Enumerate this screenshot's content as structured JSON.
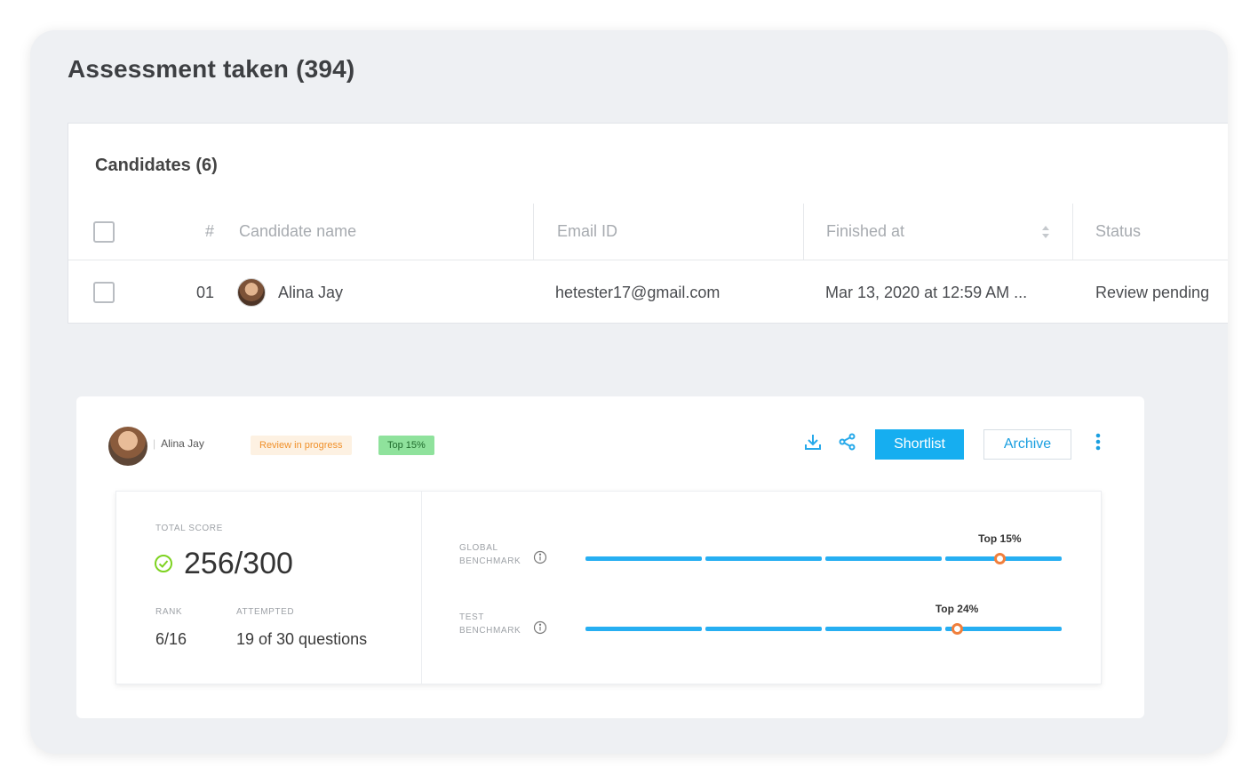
{
  "page": {
    "title": "Assessment taken (394)"
  },
  "candidates": {
    "title": "Candidates (6)",
    "columns": [
      "#",
      "Candidate name",
      "Email ID",
      "Finished at",
      "Status"
    ],
    "rows": [
      {
        "num": "01",
        "name": "Alina Jay",
        "email": "hetester17@gmail.com",
        "finished": "Mar 13, 2020 at 12:59 AM ...",
        "status": "Review pending"
      }
    ]
  },
  "detail": {
    "name": "Alina Jay",
    "badge_review": "Review in progress",
    "badge_top": "Top 15%",
    "shortlist_label": "Shortlist",
    "archive_label": "Archive",
    "total_score_label": "TOTAL SCORE",
    "total_score": "256/300",
    "rank_label": "RANK",
    "rank": "6/16",
    "attempted_label": "ATTEMPTED",
    "attempted": "19 of 30 questions",
    "benchmarks": [
      {
        "label_line1": "GLOBAL",
        "label_line2": "BENCHMARK",
        "top_label": "Top 15%",
        "position": 0.87
      },
      {
        "label_line1": "TEST",
        "label_line2": "BENCHMARK",
        "top_label": "Top 24%",
        "position": 0.78
      }
    ]
  },
  "colors": {
    "accent": "#16aef0",
    "marker": "#f07f3c",
    "badge_green": "#8fe29c",
    "badge_orange": "#f0902a"
  },
  "icons": [
    "download-icon",
    "share-icon",
    "kebab-menu-icon",
    "check-circle-icon",
    "info-icon",
    "sort-icon"
  ]
}
